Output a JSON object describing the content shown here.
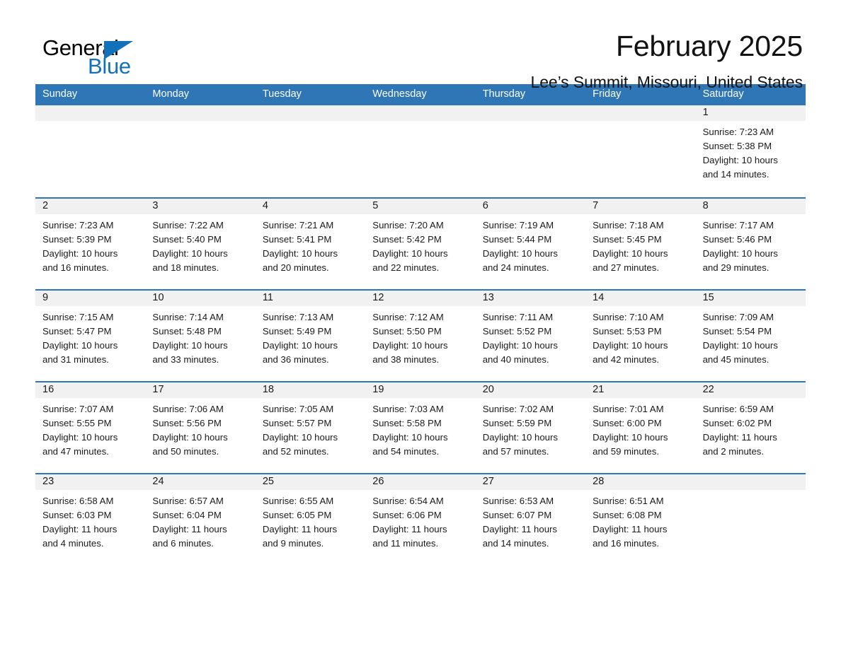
{
  "logo": {
    "part1": "General",
    "part2": "Blue",
    "triangle_color": "#1271b8"
  },
  "header": {
    "title": "February 2025",
    "subtitle": "Lee’s Summit, Missouri, United States"
  },
  "theme": {
    "header_blue": "#2e76b6",
    "daynum_gray": "#f1f1f1",
    "text": "#1a1a1a"
  },
  "weekdays": [
    "Sunday",
    "Monday",
    "Tuesday",
    "Wednesday",
    "Thursday",
    "Friday",
    "Saturday"
  ],
  "weeks": [
    [
      {
        "day": "",
        "lines": []
      },
      {
        "day": "",
        "lines": []
      },
      {
        "day": "",
        "lines": []
      },
      {
        "day": "",
        "lines": []
      },
      {
        "day": "",
        "lines": []
      },
      {
        "day": "",
        "lines": []
      },
      {
        "day": "1",
        "lines": [
          "Sunrise: 7:23 AM",
          "Sunset: 5:38 PM",
          "Daylight: 10 hours",
          "and 14 minutes."
        ]
      }
    ],
    [
      {
        "day": "2",
        "lines": [
          "Sunrise: 7:23 AM",
          "Sunset: 5:39 PM",
          "Daylight: 10 hours",
          "and 16 minutes."
        ]
      },
      {
        "day": "3",
        "lines": [
          "Sunrise: 7:22 AM",
          "Sunset: 5:40 PM",
          "Daylight: 10 hours",
          "and 18 minutes."
        ]
      },
      {
        "day": "4",
        "lines": [
          "Sunrise: 7:21 AM",
          "Sunset: 5:41 PM",
          "Daylight: 10 hours",
          "and 20 minutes."
        ]
      },
      {
        "day": "5",
        "lines": [
          "Sunrise: 7:20 AM",
          "Sunset: 5:42 PM",
          "Daylight: 10 hours",
          "and 22 minutes."
        ]
      },
      {
        "day": "6",
        "lines": [
          "Sunrise: 7:19 AM",
          "Sunset: 5:44 PM",
          "Daylight: 10 hours",
          "and 24 minutes."
        ]
      },
      {
        "day": "7",
        "lines": [
          "Sunrise: 7:18 AM",
          "Sunset: 5:45 PM",
          "Daylight: 10 hours",
          "and 27 minutes."
        ]
      },
      {
        "day": "8",
        "lines": [
          "Sunrise: 7:17 AM",
          "Sunset: 5:46 PM",
          "Daylight: 10 hours",
          "and 29 minutes."
        ]
      }
    ],
    [
      {
        "day": "9",
        "lines": [
          "Sunrise: 7:15 AM",
          "Sunset: 5:47 PM",
          "Daylight: 10 hours",
          "and 31 minutes."
        ]
      },
      {
        "day": "10",
        "lines": [
          "Sunrise: 7:14 AM",
          "Sunset: 5:48 PM",
          "Daylight: 10 hours",
          "and 33 minutes."
        ]
      },
      {
        "day": "11",
        "lines": [
          "Sunrise: 7:13 AM",
          "Sunset: 5:49 PM",
          "Daylight: 10 hours",
          "and 36 minutes."
        ]
      },
      {
        "day": "12",
        "lines": [
          "Sunrise: 7:12 AM",
          "Sunset: 5:50 PM",
          "Daylight: 10 hours",
          "and 38 minutes."
        ]
      },
      {
        "day": "13",
        "lines": [
          "Sunrise: 7:11 AM",
          "Sunset: 5:52 PM",
          "Daylight: 10 hours",
          "and 40 minutes."
        ]
      },
      {
        "day": "14",
        "lines": [
          "Sunrise: 7:10 AM",
          "Sunset: 5:53 PM",
          "Daylight: 10 hours",
          "and 42 minutes."
        ]
      },
      {
        "day": "15",
        "lines": [
          "Sunrise: 7:09 AM",
          "Sunset: 5:54 PM",
          "Daylight: 10 hours",
          "and 45 minutes."
        ]
      }
    ],
    [
      {
        "day": "16",
        "lines": [
          "Sunrise: 7:07 AM",
          "Sunset: 5:55 PM",
          "Daylight: 10 hours",
          "and 47 minutes."
        ]
      },
      {
        "day": "17",
        "lines": [
          "Sunrise: 7:06 AM",
          "Sunset: 5:56 PM",
          "Daylight: 10 hours",
          "and 50 minutes."
        ]
      },
      {
        "day": "18",
        "lines": [
          "Sunrise: 7:05 AM",
          "Sunset: 5:57 PM",
          "Daylight: 10 hours",
          "and 52 minutes."
        ]
      },
      {
        "day": "19",
        "lines": [
          "Sunrise: 7:03 AM",
          "Sunset: 5:58 PM",
          "Daylight: 10 hours",
          "and 54 minutes."
        ]
      },
      {
        "day": "20",
        "lines": [
          "Sunrise: 7:02 AM",
          "Sunset: 5:59 PM",
          "Daylight: 10 hours",
          "and 57 minutes."
        ]
      },
      {
        "day": "21",
        "lines": [
          "Sunrise: 7:01 AM",
          "Sunset: 6:00 PM",
          "Daylight: 10 hours",
          "and 59 minutes."
        ]
      },
      {
        "day": "22",
        "lines": [
          "Sunrise: 6:59 AM",
          "Sunset: 6:02 PM",
          "Daylight: 11 hours",
          "and 2 minutes."
        ]
      }
    ],
    [
      {
        "day": "23",
        "lines": [
          "Sunrise: 6:58 AM",
          "Sunset: 6:03 PM",
          "Daylight: 11 hours",
          "and 4 minutes."
        ]
      },
      {
        "day": "24",
        "lines": [
          "Sunrise: 6:57 AM",
          "Sunset: 6:04 PM",
          "Daylight: 11 hours",
          "and 6 minutes."
        ]
      },
      {
        "day": "25",
        "lines": [
          "Sunrise: 6:55 AM",
          "Sunset: 6:05 PM",
          "Daylight: 11 hours",
          "and 9 minutes."
        ]
      },
      {
        "day": "26",
        "lines": [
          "Sunrise: 6:54 AM",
          "Sunset: 6:06 PM",
          "Daylight: 11 hours",
          "and 11 minutes."
        ]
      },
      {
        "day": "27",
        "lines": [
          "Sunrise: 6:53 AM",
          "Sunset: 6:07 PM",
          "Daylight: 11 hours",
          "and 14 minutes."
        ]
      },
      {
        "day": "28",
        "lines": [
          "Sunrise: 6:51 AM",
          "Sunset: 6:08 PM",
          "Daylight: 11 hours",
          "and 16 minutes."
        ]
      },
      {
        "day": "",
        "lines": []
      }
    ]
  ]
}
